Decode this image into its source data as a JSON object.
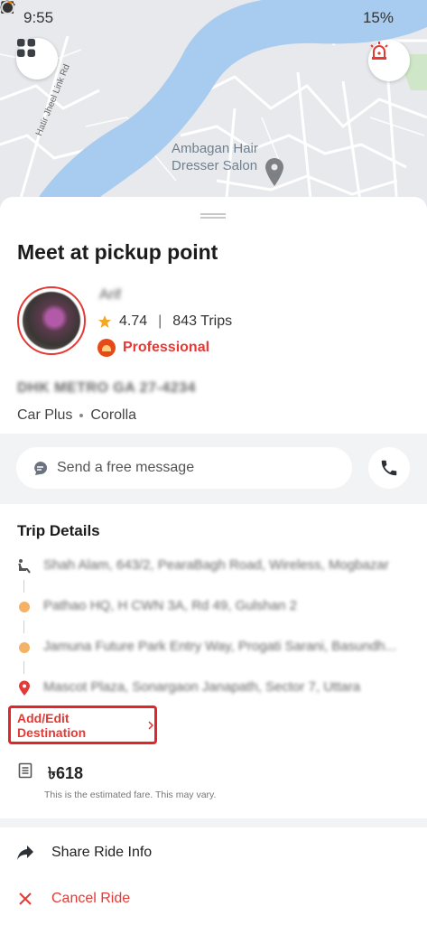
{
  "status_bar": {
    "time": "9:55",
    "battery": "15%"
  },
  "map": {
    "place_label_line1": "Ambagan Hair",
    "place_label_line2": "Dresser Salon",
    "road_label": "Hatir Jheel Link Rd",
    "colors": {
      "water": "#a8ccef",
      "land": "#e8e9ec",
      "road": "#ffffff"
    }
  },
  "sheet": {
    "title": "Meet at pickup point",
    "driver": {
      "name": "Arif",
      "rating": "4.74",
      "trips": "843 Trips",
      "tier": "Professional"
    },
    "vehicle": {
      "plate": "DHK METRO GA 27-4234",
      "category": "Car Plus",
      "model": "Corolla"
    },
    "message_placeholder": "Send a free message",
    "trip_details_title": "Trip Details",
    "stops": [
      {
        "type": "pickup",
        "address": "Shah Alam, 643/2, PearaBagh Road, Wireless, Mogbazar"
      },
      {
        "type": "stop",
        "address": "Pathao HQ, H CWN 3A, Rd 49, Gulshan 2"
      },
      {
        "type": "stop",
        "address": "Jamuna Future Park Entry Way, Progati Sarani, Basundh..."
      },
      {
        "type": "destination",
        "address": "Mascot Plaza, Sonargaon Janapath, Sector 7, Uttara"
      }
    ],
    "edit_destination": "Add/Edit Destination",
    "fare": "৳618",
    "fare_note": "This is the estimated fare. This may vary.",
    "actions": {
      "share": "Share Ride Info",
      "cancel": "Cancel Ride"
    }
  },
  "colors": {
    "accent_red": "#e53935",
    "stop_orange": "#f4b266",
    "rating_star": "#f5a623"
  }
}
